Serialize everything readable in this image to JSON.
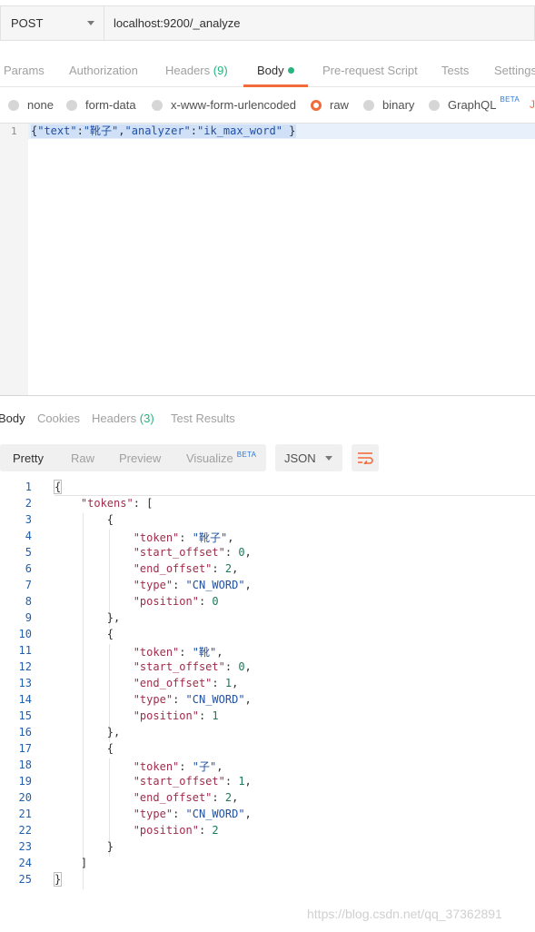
{
  "request": {
    "method": "POST",
    "url": "localhost:9200/_analyze"
  },
  "request_tabs": [
    {
      "label": "Params"
    },
    {
      "label": "Authorization"
    },
    {
      "label": "Headers",
      "count": "(9)"
    },
    {
      "label": "Body",
      "active": true,
      "indicator": "green-dot"
    },
    {
      "label": "Pre-request Script"
    },
    {
      "label": "Tests"
    },
    {
      "label": "Settings"
    }
  ],
  "body_types": [
    {
      "label": "none"
    },
    {
      "label": "form-data"
    },
    {
      "label": "x-www-form-urlencoded"
    },
    {
      "label": "raw",
      "selected": true
    },
    {
      "label": "binary"
    },
    {
      "label": "GraphQL",
      "badge": "BETA"
    }
  ],
  "body_types_overflow": "JS",
  "request_body": {
    "line_number": "1",
    "text": "{\"text\":\"靴子\",\"analyzer\":\"ik_max_word\" }"
  },
  "response_tabs": [
    {
      "label": "Body",
      "active": true
    },
    {
      "label": "Cookies"
    },
    {
      "label": "Headers",
      "count": "(3)"
    },
    {
      "label": "Test Results"
    }
  ],
  "response_views": [
    {
      "label": "Pretty",
      "active": true
    },
    {
      "label": "Raw"
    },
    {
      "label": "Preview"
    },
    {
      "label": "Visualize",
      "badge": "BETA"
    }
  ],
  "response_format": "JSON",
  "response_lines": [
    {
      "n": "1",
      "text": "{"
    },
    {
      "n": "2",
      "text": "    \"tokens\": ["
    },
    {
      "n": "3",
      "text": "        {"
    },
    {
      "n": "4",
      "text": "            \"token\": \"靴子\","
    },
    {
      "n": "5",
      "text": "            \"start_offset\": 0,"
    },
    {
      "n": "6",
      "text": "            \"end_offset\": 2,"
    },
    {
      "n": "7",
      "text": "            \"type\": \"CN_WORD\","
    },
    {
      "n": "8",
      "text": "            \"position\": 0"
    },
    {
      "n": "9",
      "text": "        },"
    },
    {
      "n": "10",
      "text": "        {"
    },
    {
      "n": "11",
      "text": "            \"token\": \"靴\","
    },
    {
      "n": "12",
      "text": "            \"start_offset\": 0,"
    },
    {
      "n": "13",
      "text": "            \"end_offset\": 1,"
    },
    {
      "n": "14",
      "text": "            \"type\": \"CN_WORD\","
    },
    {
      "n": "15",
      "text": "            \"position\": 1"
    },
    {
      "n": "16",
      "text": "        },"
    },
    {
      "n": "17",
      "text": "        {"
    },
    {
      "n": "18",
      "text": "            \"token\": \"子\","
    },
    {
      "n": "19",
      "text": "            \"start_offset\": 1,"
    },
    {
      "n": "20",
      "text": "            \"end_offset\": 2,"
    },
    {
      "n": "21",
      "text": "            \"type\": \"CN_WORD\","
    },
    {
      "n": "22",
      "text": "            \"position\": 2"
    },
    {
      "n": "23",
      "text": "        }"
    },
    {
      "n": "24",
      "text": "    ]"
    },
    {
      "n": "25",
      "text": "}"
    }
  ],
  "watermark": "https://blog.csdn.net/qq_37362891",
  "colors": {
    "accent": "#f26b3a",
    "count_green": "#26b47f",
    "beta_blue": "#2e7ad6",
    "json_key": "#a02c4c",
    "json_string": "#2151a3",
    "json_number": "#1a7a5a",
    "line_number": "#1f5fad"
  }
}
